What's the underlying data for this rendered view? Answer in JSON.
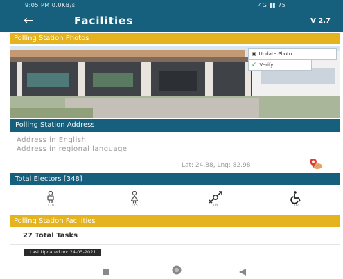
{
  "status_bar": {
    "time": "9:05 PM  0.0KB/s",
    "system": "4G  ▮▮  75"
  },
  "app_bar": {
    "back_icon": "arrow-left-icon",
    "title": "Facilities",
    "version": "V 2.7"
  },
  "photos_section": {
    "title": "Polling Station Photos",
    "update_photo_label": "Update Photo",
    "verify_label": "Verify"
  },
  "address_section": {
    "title": "Polling Station Address",
    "address_english": "Address in English",
    "address_regional": "Address in regional language",
    "lat_lng": "Lat: 24.88, Lng: 82.98"
  },
  "electors_section": {
    "title": "Total Electors [348]",
    "items": [
      {
        "icon": "male-icon",
        "count": "170"
      },
      {
        "icon": "female-icon",
        "count": "175"
      },
      {
        "icon": "third-gender-icon",
        "count": "03"
      },
      {
        "icon": "wheelchair-icon",
        "count": "02"
      }
    ]
  },
  "facilities_section": {
    "title": "Polling Station Facilities",
    "total_tasks": "27 Total Tasks",
    "last_updated": "Last Updated on: 24-05-2021"
  },
  "colors": {
    "primary": "#17607d",
    "accent": "#e4b31e",
    "verify_check": "#3aa64c",
    "pin_red": "#e23b2f"
  }
}
